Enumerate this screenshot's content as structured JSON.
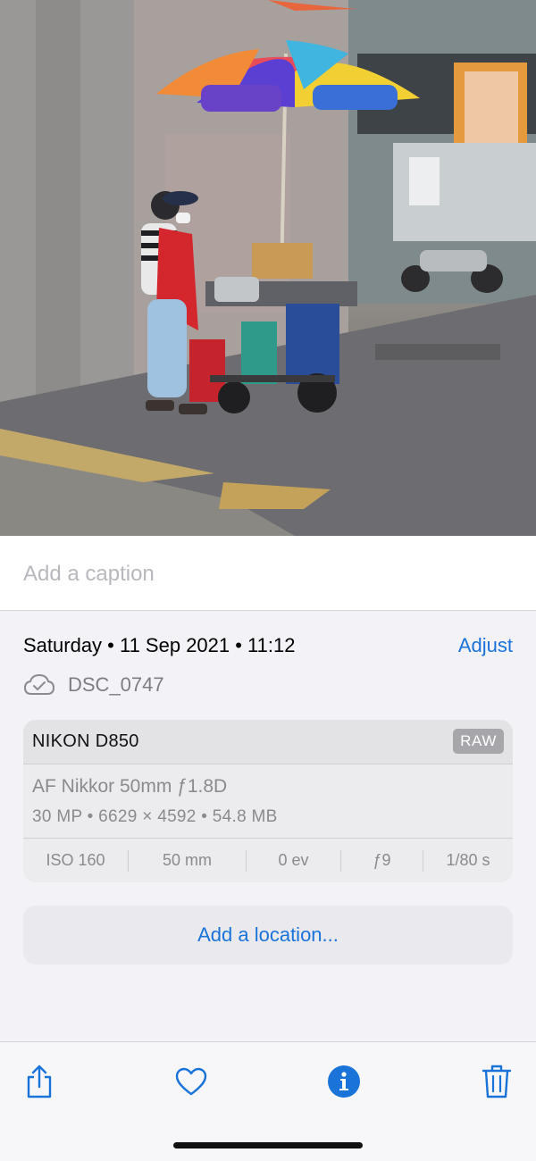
{
  "photo": {
    "description_icon": "photo-viewer-image"
  },
  "caption": {
    "placeholder": "Add a caption",
    "value": ""
  },
  "info": {
    "date": "Saturday • 11 Sep 2021 • 11:12",
    "adjust_label": "Adjust",
    "file_icon": "cloud-checkmark-icon",
    "file_name": "DSC_0747"
  },
  "camera": {
    "model": "NIKON D850",
    "format_badge": "RAW",
    "lens": "AF Nikkor 50mm ƒ1.8D",
    "specs": "30 MP  •  6629 × 4592  •  54.8 MB",
    "exif": [
      {
        "label": "ISO 160"
      },
      {
        "label": "50 mm"
      },
      {
        "label": "0 ev"
      },
      {
        "label": "ƒ9"
      },
      {
        "label": "1/80 s"
      }
    ]
  },
  "location": {
    "label": "Add a location..."
  },
  "toolbar": {
    "items": [
      {
        "name": "share",
        "icon": "share-icon"
      },
      {
        "name": "favorite",
        "icon": "heart-icon"
      },
      {
        "name": "info",
        "icon": "info-icon"
      },
      {
        "name": "delete",
        "icon": "trash-icon"
      }
    ]
  },
  "colors": {
    "accent": "#1a73d9",
    "background": "#f2f2f7",
    "secondary_text": "#8a8a8f"
  }
}
